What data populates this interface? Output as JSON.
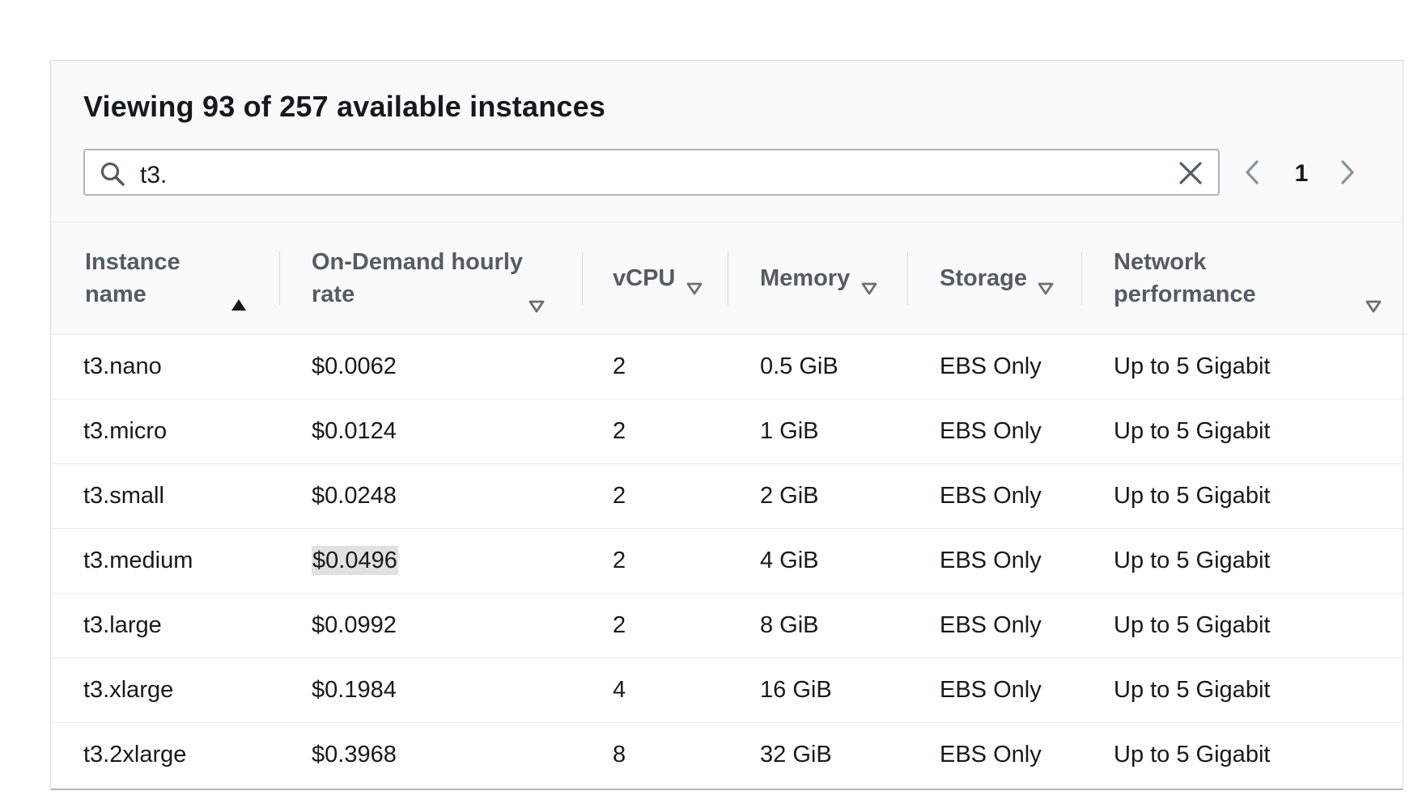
{
  "header": {
    "title": "Viewing 93 of 257 available instances"
  },
  "search": {
    "value": "t3."
  },
  "pagination": {
    "current_page": "1"
  },
  "table": {
    "columns": [
      {
        "label_line1": "Instance",
        "label_line2": "name",
        "sort": "ascending-active"
      },
      {
        "label_line1": "On-Demand hourly",
        "label_line2": "rate",
        "sort": "descending"
      },
      {
        "label_line1": "vCPU",
        "label_line2": "",
        "sort": "descending"
      },
      {
        "label_line1": "Memory",
        "label_line2": "",
        "sort": "descending"
      },
      {
        "label_line1": "Storage",
        "label_line2": "",
        "sort": "descending"
      },
      {
        "label_line1": "Network",
        "label_line2": "performance",
        "sort": "descending"
      }
    ],
    "rows": [
      {
        "name": "t3.nano",
        "rate": "$0.0062",
        "vcpu": "2",
        "memory": "0.5 GiB",
        "storage": "EBS Only",
        "network": "Up to 5 Gigabit"
      },
      {
        "name": "t3.micro",
        "rate": "$0.0124",
        "vcpu": "2",
        "memory": "1 GiB",
        "storage": "EBS Only",
        "network": "Up to 5 Gigabit"
      },
      {
        "name": "t3.small",
        "rate": "$0.0248",
        "vcpu": "2",
        "memory": "2 GiB",
        "storage": "EBS Only",
        "network": "Up to 5 Gigabit"
      },
      {
        "name": "t3.medium",
        "rate": "$0.0496",
        "vcpu": "2",
        "memory": "4 GiB",
        "storage": "EBS Only",
        "network": "Up to 5 Gigabit"
      },
      {
        "name": "t3.large",
        "rate": "$0.0992",
        "vcpu": "2",
        "memory": "8 GiB",
        "storage": "EBS Only",
        "network": "Up to 5 Gigabit"
      },
      {
        "name": "t3.xlarge",
        "rate": "$0.1984",
        "vcpu": "4",
        "memory": "16 GiB",
        "storage": "EBS Only",
        "network": "Up to 5 Gigabit"
      },
      {
        "name": "t3.2xlarge",
        "rate": "$0.3968",
        "vcpu": "8",
        "memory": "32 GiB",
        "storage": "EBS Only",
        "network": "Up to 5 Gigabit"
      }
    ]
  },
  "colors": {
    "text_primary": "#16191f",
    "text_header": "#545b64",
    "header_background": "#fafafa",
    "border": "#d5dbdb",
    "icon": "#545b64",
    "highlight": "#e1e1e1"
  },
  "icons": {
    "search": "search-icon",
    "clear": "close-icon",
    "prev": "chevron-left-icon",
    "next": "chevron-right-icon",
    "sort_asc": "caret-up-filled-icon",
    "sort_desc": "caret-down-outline-icon"
  }
}
